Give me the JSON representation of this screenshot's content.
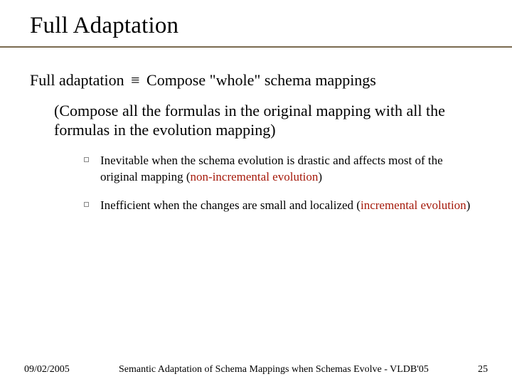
{
  "title": "Full Adaptation",
  "line1": {
    "lead": "Full adaptation",
    "equiv": "≡",
    "rest": "Compose \"whole\" schema mappings"
  },
  "paren": "(Compose all the formulas in the original mapping with all the formulas in the evolution mapping)",
  "bullets": [
    {
      "pre": "Inevitable when the schema evolution is drastic and affects most of the original mapping (",
      "em": "non-incremental evolution",
      "post": ")"
    },
    {
      "pre": "Inefficient when the changes are small and localized (",
      "em": "incremental evolution",
      "post": ")"
    }
  ],
  "footer": {
    "date": "09/02/2005",
    "mid": "Semantic Adaptation of Schema Mappings when Schemas Evolve  -  VLDB'05",
    "page": "25"
  }
}
